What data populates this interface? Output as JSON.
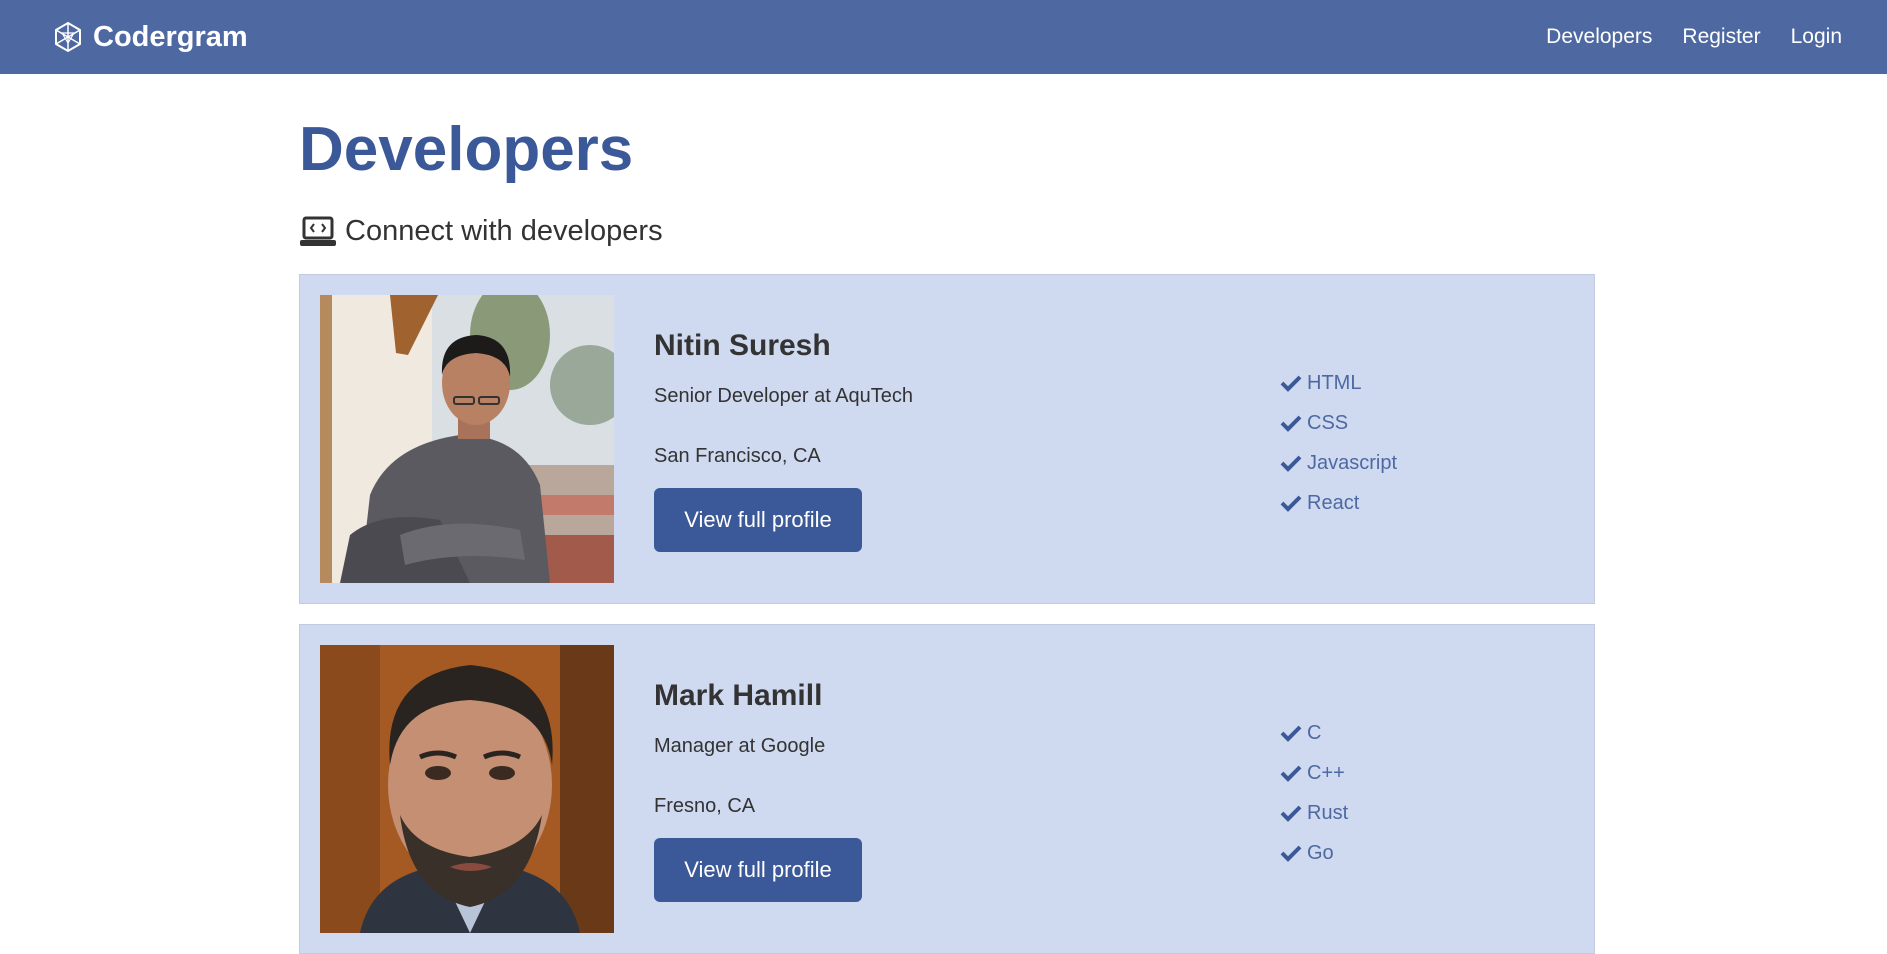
{
  "navbar": {
    "brand": "Codergram",
    "links": [
      "Developers",
      "Register",
      "Login"
    ]
  },
  "page": {
    "title": "Developers",
    "lead": "Connect with developers"
  },
  "profiles": [
    {
      "name": "Nitin Suresh",
      "status": "Senior Developer at AquTech",
      "location": "San Francisco, CA",
      "button": "View full profile",
      "skills": [
        "HTML",
        "CSS",
        "Javascript",
        "React"
      ]
    },
    {
      "name": "Mark Hamill",
      "status": "Manager at Google",
      "location": "Fresno, CA",
      "button": "View full profile",
      "skills": [
        "C",
        "C++",
        "Rust",
        "Go"
      ]
    }
  ],
  "colors": {
    "navbar": "#4e69a2",
    "primary": "#3b5998",
    "card": "#cfd9f0"
  }
}
